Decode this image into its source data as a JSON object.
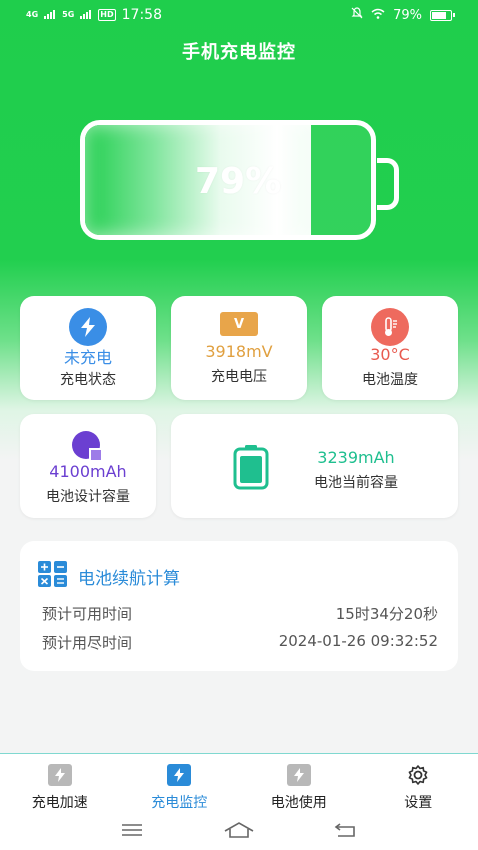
{
  "status_bar": {
    "network1": "4G",
    "network2": "5G",
    "hd": "HD",
    "time": "17:58",
    "battery_text": "79%"
  },
  "page": {
    "title": "手机充电监控"
  },
  "battery": {
    "percent_label": "79%",
    "level": 0.79
  },
  "cards": {
    "charge_state": {
      "value": "未充电",
      "label": "充电状态",
      "color": "#3a8ee6"
    },
    "voltage": {
      "value": "3918mV",
      "label": "充电电压",
      "color": "#e0a040",
      "icon_letter": "V"
    },
    "temperature": {
      "value": "30°C",
      "label": "电池温度",
      "color": "#e85a4f"
    },
    "design_capacity": {
      "value": "4100mAh",
      "label": "电池设计容量",
      "color": "#6b3fd1"
    },
    "current_capacity": {
      "value": "3239mAh",
      "label": "电池当前容量",
      "color": "#1fbf8f"
    }
  },
  "calc": {
    "title": "电池续航计算",
    "rows": [
      {
        "label": "预计可用时间",
        "value": "15时34分20秒"
      },
      {
        "label": "预计用尽时间",
        "value": "2024-01-26 09:32:52"
      }
    ]
  },
  "nav": {
    "items": [
      {
        "label": "充电加速",
        "icon": "bolt-box-icon",
        "active": false
      },
      {
        "label": "充电监控",
        "icon": "bolt-box-icon",
        "active": true
      },
      {
        "label": "电池使用",
        "icon": "bolt-box-icon",
        "active": false
      },
      {
        "label": "设置",
        "icon": "gear-icon",
        "active": false
      }
    ]
  },
  "colors": {
    "brand_green": "#22cf4f",
    "accent_blue": "#2a8bd8"
  }
}
